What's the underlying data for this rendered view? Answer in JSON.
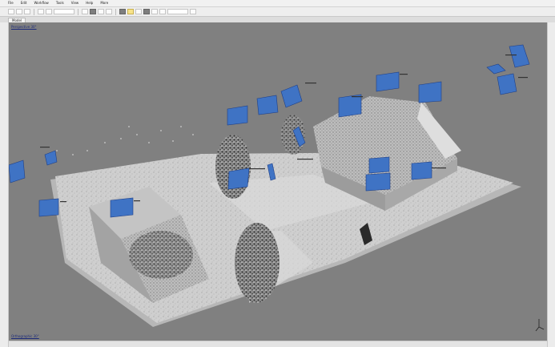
{
  "menubar": {
    "items": [
      "File",
      "Edit",
      "Workflow",
      "Tools",
      "View",
      "Help",
      "More"
    ]
  },
  "toolbar": {
    "icons": [
      "new-icon",
      "open-icon",
      "save-icon",
      "undo-icon",
      "redo-icon",
      "select-icon",
      "rotate-icon",
      "pan-icon",
      "zoom-icon",
      "point-cloud-icon",
      "mesh-icon",
      "texture-icon",
      "camera-icon",
      "markers-icon",
      "shapes-icon",
      "ruler-icon"
    ]
  },
  "tabs": [
    {
      "label": "Model"
    }
  ],
  "viewport": {
    "top_label": "Perspective 30°",
    "bottom_label": "Orthographic 30°"
  },
  "colors": {
    "viewport_bg": "#808080",
    "camera_blue": "#3f73c4",
    "terrain": "#d2d2d2"
  }
}
